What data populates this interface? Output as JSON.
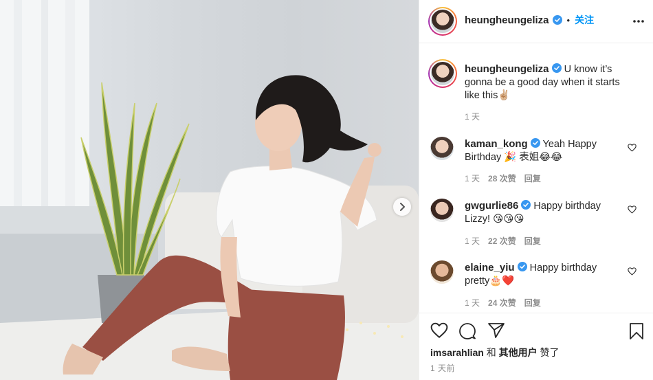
{
  "post": {
    "author": "heungheungeliza",
    "follow_dot": "•",
    "follow_label": "关注",
    "caption_text": " U know it’s gonna be a good day when it starts like this✌🏼",
    "caption_time": "1 天"
  },
  "comments": [
    {
      "user": "kaman_kong",
      "text": " Yeah Happy Birthday 🎉 表姐😂😂",
      "time": "1 天",
      "likes": "28 次赞",
      "reply": "回复"
    },
    {
      "user": "gwgurlie86",
      "text": " Happy birthday Lizzy! 😘😘😘",
      "time": "1 天",
      "likes": "22 次赞",
      "reply": "回复"
    },
    {
      "user": "elaine_yiu",
      "text": " Happy birthday pretty🎂❤️",
      "time": "1 天",
      "likes": "24 次赞",
      "reply": "回复"
    }
  ],
  "likes_line": {
    "user": "imsarahlian",
    "and": "和",
    "others": "其他用户",
    "suffix": "赞了"
  },
  "post_time": "1 天前",
  "colors": {
    "accent": "#0095f6",
    "muted": "#8e8e8e",
    "text": "#262626"
  },
  "icons": [
    "verified-badge-icon",
    "more-options-icon",
    "heart-icon",
    "comment-icon",
    "share-icon",
    "bookmark-icon",
    "chevron-right-icon"
  ]
}
